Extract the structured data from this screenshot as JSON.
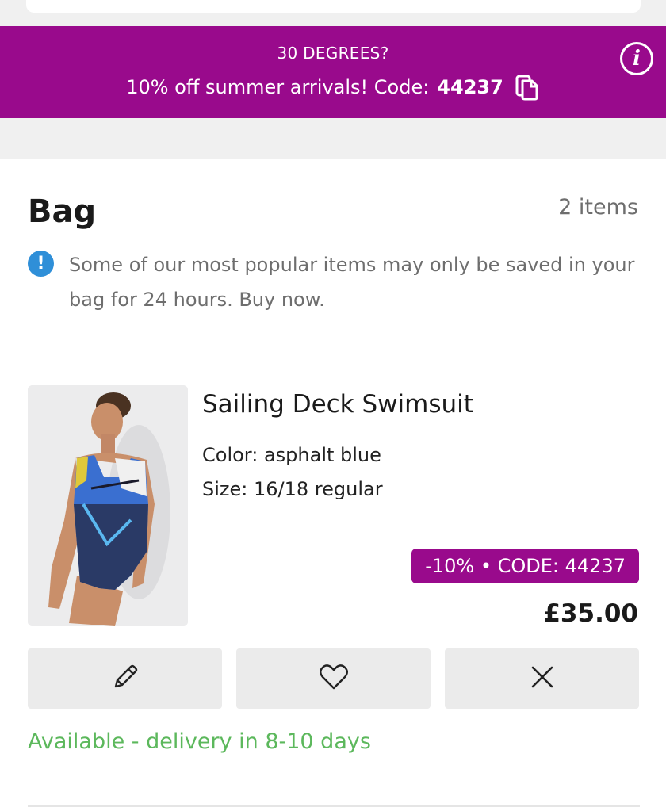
{
  "promo": {
    "title": "30 DEGREES?",
    "message": "10% off summer arrivals! Code:",
    "code": "44237",
    "background_color": "#990a8c"
  },
  "icons": {
    "info": "info-icon",
    "copy": "copy-icon",
    "notice": "exclamation-icon",
    "edit": "pencil-icon",
    "wishlist": "heart-icon",
    "remove": "close-icon"
  },
  "bag": {
    "title": "Bag",
    "item_count": "2 items",
    "notice": "Some of our most popular items may only be saved in your bag for 24 hours. Buy now."
  },
  "product": {
    "name": "Sailing Deck Swimsuit",
    "color": "Color: asphalt blue",
    "size": "Size: 16/18 regular",
    "discount_badge": "-10% • CODE: 44237",
    "price": "£35.00",
    "availability": "Available - delivery in 8-10 days",
    "availability_color": "#5cb85c"
  }
}
